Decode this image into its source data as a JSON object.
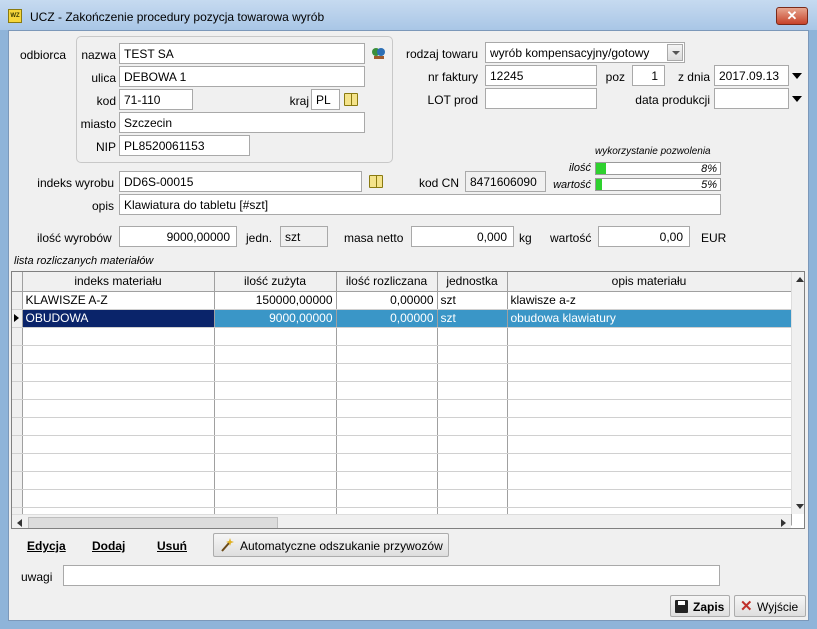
{
  "window": {
    "title": "UCZ - Zakończenie procedury pozycja towarowa wyrób",
    "icon_text": "WZ"
  },
  "odbiorca": {
    "section_label": "odbiorca",
    "nazwa_label": "nazwa",
    "nazwa": "TEST SA",
    "ulica_label": "ulica",
    "ulica": "DEBOWA 1",
    "kod_label": "kod",
    "kod": "71-110",
    "kraj_label": "kraj",
    "kraj": "PL",
    "miasto_label": "miasto",
    "miasto": "Szczecin",
    "nip_label": "NIP",
    "nip": "PL8520061153"
  },
  "towar": {
    "rodzaj_label": "rodzaj towaru",
    "rodzaj": "wyrób kompensacyjny/gotowy",
    "nr_faktury_label": "nr faktury",
    "nr_faktury": "12245",
    "poz_label": "poz",
    "poz": "1",
    "z_dnia_label": "z dnia",
    "z_dnia": "2017.09.13",
    "lot_label": "LOT prod",
    "lot": "",
    "data_prod_label": "data produkcji",
    "data_prod": ""
  },
  "pozwolenie": {
    "header": "wykorzystanie pozwolenia",
    "ilosc_label": "ilość",
    "ilosc_pct": 8,
    "ilosc_text": "8%",
    "wartosc_label": "wartość",
    "wartosc_pct": 5,
    "wartosc_text": "5%"
  },
  "wyrob": {
    "indeks_label": "indeks wyrobu",
    "indeks": "DD6S-00015",
    "kod_cn_label": "kod CN",
    "kod_cn": "8471606090",
    "opis_label": "opis",
    "opis": "Klawiatura do tabletu [#szt]",
    "ilosc_label": "ilość wyrobów",
    "ilosc": "9000,00000",
    "jedn_label": "jedn.",
    "jedn": "szt",
    "masa_label": "masa netto",
    "masa": "0,000",
    "masa_unit": "kg",
    "wartosc_label": "wartość",
    "wartosc": "0,00",
    "waluta": "EUR"
  },
  "grid": {
    "caption": "lista rozliczanych materiałów",
    "columns": [
      "indeks materiału",
      "ilość zużyta",
      "ilość rozliczana",
      "jednostka",
      "opis materiału"
    ],
    "rows": [
      [
        "KLAWISZE A-Z",
        "150000,00000",
        "0,00000",
        "szt",
        "klawisze a-z"
      ],
      [
        "OBUDOWA",
        "9000,00000",
        "0,00000",
        "szt",
        "obudowa klawiatury"
      ]
    ],
    "empty_rows": 11
  },
  "actions": {
    "edycja": "Edycja",
    "dodaj": "Dodaj",
    "usun": "Usuń",
    "auto": "Automatyczne odszukanie przywozów"
  },
  "uwagi": {
    "label": "uwagi",
    "value": ""
  },
  "footer": {
    "zapis": "Zapis",
    "wyjscie": "Wyjście"
  }
}
